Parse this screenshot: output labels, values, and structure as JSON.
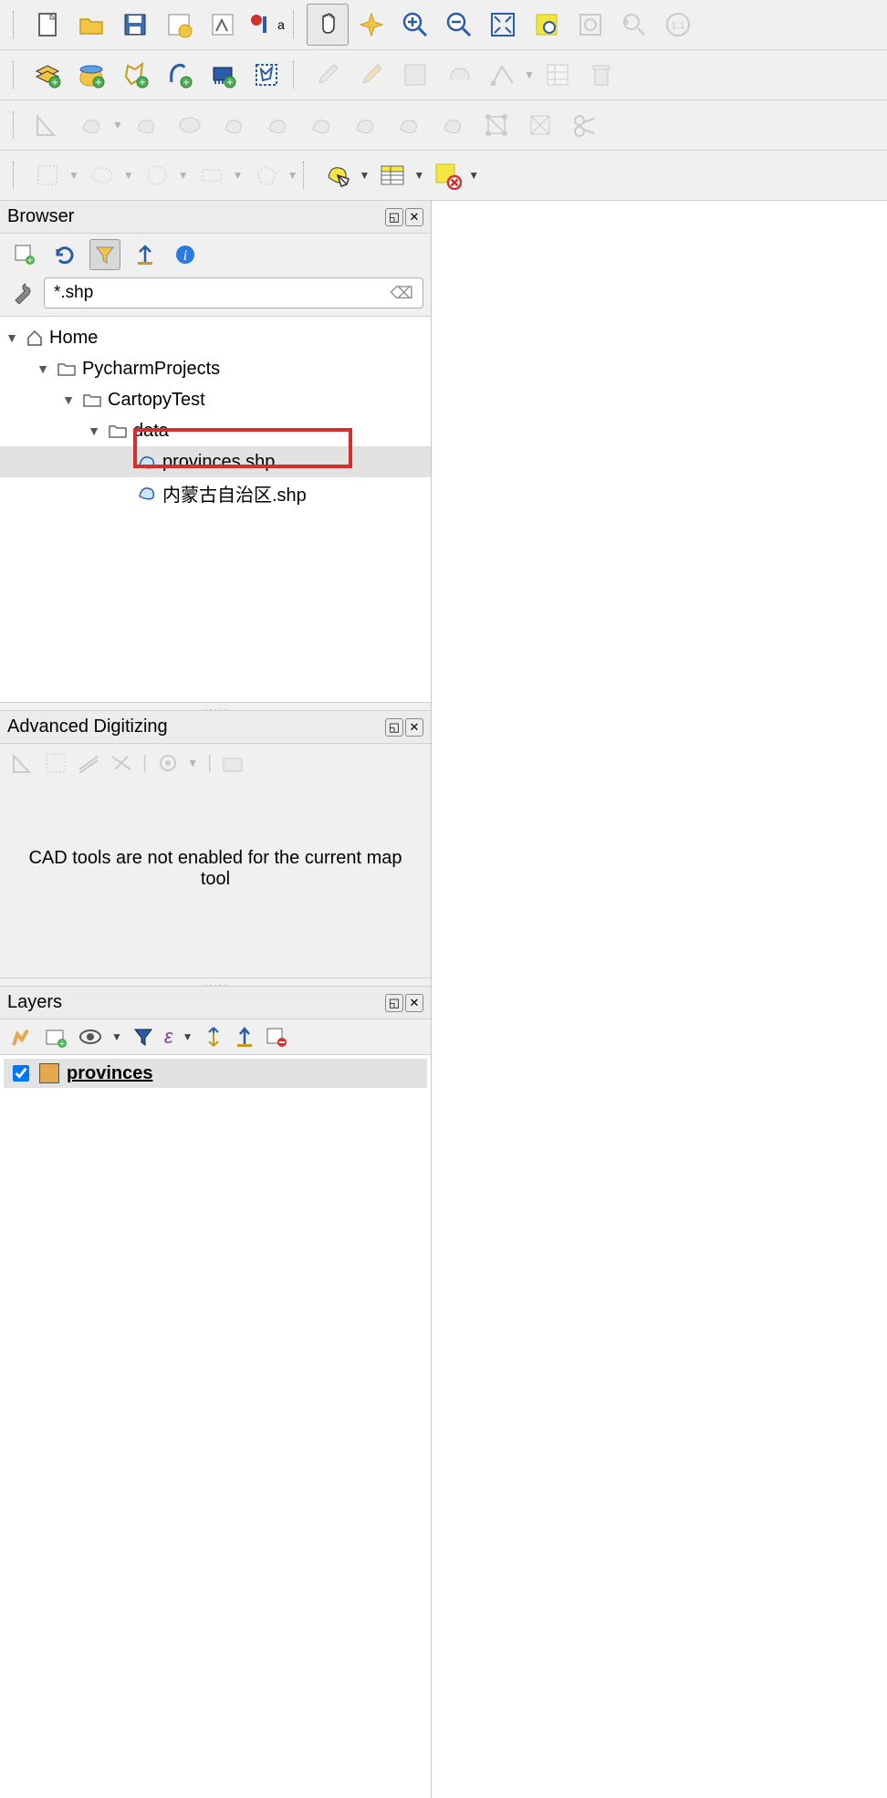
{
  "toolbar1": {
    "new": "new",
    "open": "open",
    "save": "save",
    "layout": "layout",
    "style": "style",
    "annot": "annot",
    "pan": "pan",
    "fullpan": "fullpan",
    "zoomin": "zoomin",
    "zoomout": "zoomout",
    "zoomfull": "zoomfull",
    "zoomsel": "zoomsel",
    "zoomlayer": "zoomlayer",
    "zoomlast": "zoomlast",
    "zoom11": "1:1"
  },
  "panels": {
    "browser": {
      "title": "Browser",
      "filter": "*.shp",
      "tree": [
        {
          "level": 0,
          "label": "Home",
          "icon": "home",
          "expand": true
        },
        {
          "level": 1,
          "label": "PycharmProjects",
          "icon": "folder",
          "expand": true
        },
        {
          "level": 2,
          "label": "CartopyTest",
          "icon": "folder",
          "expand": true
        },
        {
          "level": 3,
          "label": "data",
          "icon": "folder",
          "expand": true
        },
        {
          "level": 4,
          "label": "provinces.shp",
          "icon": "shp",
          "sel": true,
          "highlight": true
        },
        {
          "level": 4,
          "label": "内蒙古自治区.shp",
          "icon": "shp"
        }
      ]
    },
    "adv": {
      "title": "Advanced Digitizing",
      "msg": "CAD tools are not enabled for the current map tool"
    },
    "layers": {
      "title": "Layers",
      "items": [
        {
          "name": "provinces",
          "checked": true,
          "color": "#e5a84e"
        }
      ]
    }
  }
}
